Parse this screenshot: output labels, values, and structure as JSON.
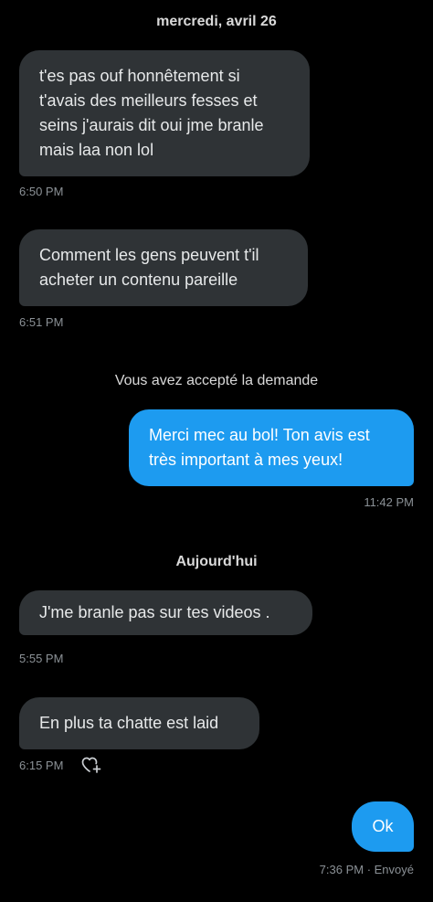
{
  "day_separators": {
    "first": "mercredi, avril 26",
    "second": "Aujourd'hui"
  },
  "system_note": "Vous avez accepté la demande",
  "messages": [
    {
      "text": "t'es pas ouf honnêtement si\nt'avais des meilleurs fesses et\nseins j'aurais dit oui jme branle\nmais laa non lol",
      "time": "6:50 PM"
    },
    {
      "text": "Comment les gens peuvent t'il\nacheter un contenu pareille",
      "time": "6:51 PM"
    },
    {
      "text": "Merci mec au bol! Ton avis est\ntrès important à mes yeux!",
      "time": "11:42 PM"
    },
    {
      "text": "J'me branle pas sur tes videos .",
      "time": "5:55 PM"
    },
    {
      "text": "En plus ta chatte est laid",
      "time": "6:15 PM"
    },
    {
      "text": "Ok",
      "time": "7:36 PM · Envoyé"
    }
  ],
  "colors": {
    "background": "#000000",
    "incoming_bubble": "#2f3336",
    "outgoing_bubble": "#1d9bf0",
    "meta_text": "#8b9196"
  },
  "icons": {
    "reaction": "heart-plus-icon"
  }
}
